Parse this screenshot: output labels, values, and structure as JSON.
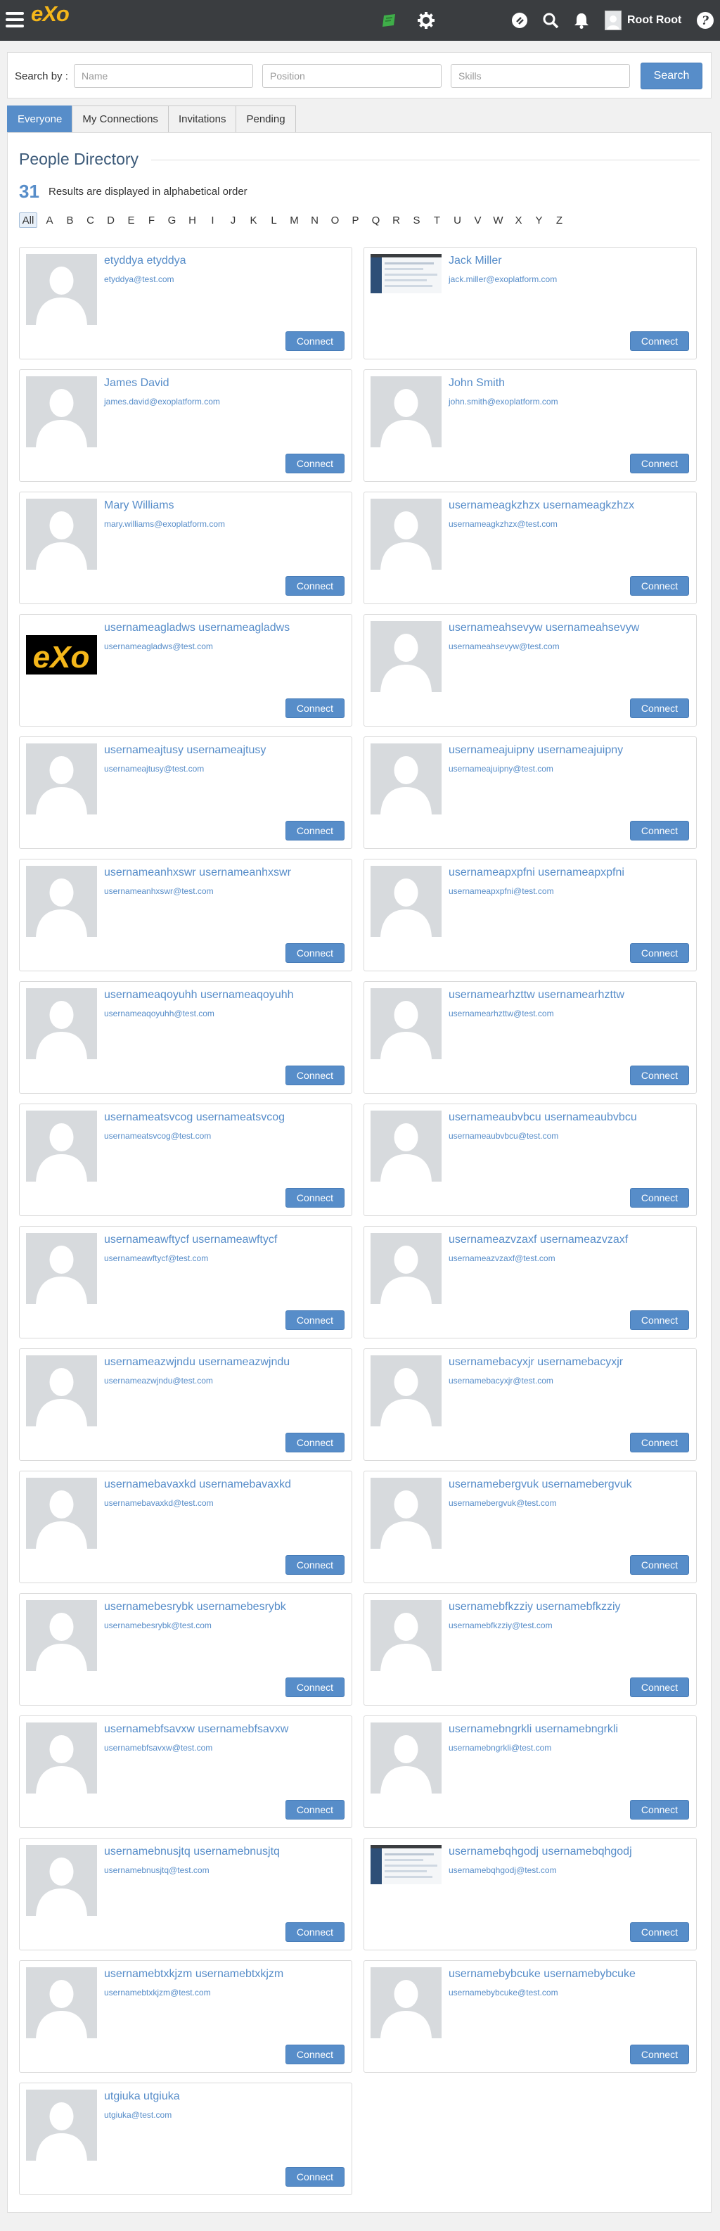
{
  "topbar": {
    "logo_text": "eXo",
    "user_name": "Root Root",
    "icons": [
      "menu-icon",
      "chat-icon",
      "settings-icon",
      "help-circle-icon",
      "search-icon",
      "bell-icon",
      "avatar",
      "help-icon"
    ]
  },
  "search": {
    "label": "Search by :",
    "name_placeholder": "Name",
    "position_placeholder": "Position",
    "skills_placeholder": "Skills",
    "button_label": "Search"
  },
  "tabs": [
    {
      "label": "Everyone",
      "active": true
    },
    {
      "label": "My Connections",
      "active": false
    },
    {
      "label": "Invitations",
      "active": false
    },
    {
      "label": "Pending",
      "active": false
    }
  ],
  "directory": {
    "title": "People Directory",
    "count": "31",
    "count_text": "Results are displayed in alphabetical order",
    "letters": [
      "All",
      "A",
      "B",
      "C",
      "D",
      "E",
      "F",
      "G",
      "H",
      "I",
      "J",
      "K",
      "L",
      "M",
      "N",
      "O",
      "P",
      "Q",
      "R",
      "S",
      "T",
      "U",
      "V",
      "W",
      "X",
      "Y",
      "Z"
    ],
    "active_letter": "All",
    "connect_label": "Connect"
  },
  "people": [
    {
      "name": "etyddya etyddya",
      "email": "etyddya@test.com",
      "avatar": "default"
    },
    {
      "name": "Jack Miller",
      "email": "jack.miller@exoplatform.com",
      "avatar": "screenshot"
    },
    {
      "name": "James David",
      "email": "james.david@exoplatform.com",
      "avatar": "default"
    },
    {
      "name": "John Smith",
      "email": "john.smith@exoplatform.com",
      "avatar": "default"
    },
    {
      "name": "Mary Williams",
      "email": "mary.williams@exoplatform.com",
      "avatar": "default"
    },
    {
      "name": "usernameagkzhzx usernameagkzhzx",
      "email": "usernameagkzhzx@test.com",
      "avatar": "default"
    },
    {
      "name": "usernameagladws usernameagladws",
      "email": "usernameagladws@test.com",
      "avatar": "exo-logo"
    },
    {
      "name": "usernameahsevyw usernameahsevyw",
      "email": "usernameahsevyw@test.com",
      "avatar": "default"
    },
    {
      "name": "usernameajtusy usernameajtusy",
      "email": "usernameajtusy@test.com",
      "avatar": "default"
    },
    {
      "name": "usernameajuipny usernameajuipny",
      "email": "usernameajuipny@test.com",
      "avatar": "default"
    },
    {
      "name": "usernameanhxswr usernameanhxswr",
      "email": "usernameanhxswr@test.com",
      "avatar": "default"
    },
    {
      "name": "usernameapxpfni usernameapxpfni",
      "email": "usernameapxpfni@test.com",
      "avatar": "default"
    },
    {
      "name": "usernameaqoyuhh usernameaqoyuhh",
      "email": "usernameaqoyuhh@test.com",
      "avatar": "default"
    },
    {
      "name": "usernamearhzttw usernamearhzttw",
      "email": "usernamearhzttw@test.com",
      "avatar": "default"
    },
    {
      "name": "usernameatsvcog usernameatsvcog",
      "email": "usernameatsvcog@test.com",
      "avatar": "default"
    },
    {
      "name": "usernameaubvbcu usernameaubvbcu",
      "email": "usernameaubvbcu@test.com",
      "avatar": "default"
    },
    {
      "name": "usernameawftycf usernameawftycf",
      "email": "usernameawftycf@test.com",
      "avatar": "default"
    },
    {
      "name": "usernameazvzaxf usernameazvzaxf",
      "email": "usernameazvzaxf@test.com",
      "avatar": "default"
    },
    {
      "name": "usernameazwjndu usernameazwjndu",
      "email": "usernameazwjndu@test.com",
      "avatar": "default"
    },
    {
      "name": "usernamebacyxjr usernamebacyxjr",
      "email": "usernamebacyxjr@test.com",
      "avatar": "default"
    },
    {
      "name": "usernamebavaxkd usernamebavaxkd",
      "email": "usernamebavaxkd@test.com",
      "avatar": "default"
    },
    {
      "name": "usernamebergvuk usernamebergvuk",
      "email": "usernamebergvuk@test.com",
      "avatar": "default"
    },
    {
      "name": "usernamebesrybk usernamebesrybk",
      "email": "usernamebesrybk@test.com",
      "avatar": "default"
    },
    {
      "name": "usernamebfkzziy usernamebfkzziy",
      "email": "usernamebfkzziy@test.com",
      "avatar": "default"
    },
    {
      "name": "usernamebfsavxw usernamebfsavxw",
      "email": "usernamebfsavxw@test.com",
      "avatar": "default"
    },
    {
      "name": "usernamebngrkli usernamebngrkli",
      "email": "usernamebngrkli@test.com",
      "avatar": "default"
    },
    {
      "name": "usernamebnusjtq usernamebnusjtq",
      "email": "usernamebnusjtq@test.com",
      "avatar": "default"
    },
    {
      "name": "usernamebqhgodj usernamebqhgodj",
      "email": "usernamebqhgodj@test.com",
      "avatar": "screenshot"
    },
    {
      "name": "usernamebtxkjzm usernamebtxkjzm",
      "email": "usernamebtxkjzm@test.com",
      "avatar": "default"
    },
    {
      "name": "usernamebybcuke usernamebybcuke",
      "email": "usernamebybcuke@test.com",
      "avatar": "default"
    },
    {
      "name": "utgiuka utgiuka",
      "email": "utgiuka@test.com",
      "avatar": "default"
    }
  ],
  "colors": {
    "topbar": "#3a3d40",
    "accent": "#578dc9",
    "logo": "#f5b71a",
    "title": "#3c5a79"
  }
}
